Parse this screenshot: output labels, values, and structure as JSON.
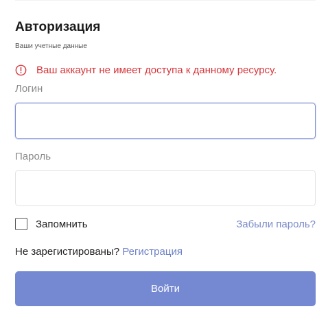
{
  "auth": {
    "title": "Авторизация",
    "subtitle": "Ваши учетные данные",
    "error_message": "Ваш аккаунт не имеет доступа к данному ресурсу.",
    "error_icon": "alert-circle-icon",
    "login_label": "Логин",
    "login_value": "",
    "password_label": "Пароль",
    "password_value": "",
    "remember_label": "Запомнить",
    "remember_checked": false,
    "forgot_password_link": "Забыли пароль?",
    "not_registered_text": "Не зарегистированы?",
    "register_link": "Регистрация",
    "submit_label": "Войти"
  },
  "colors": {
    "error": "#d6353a",
    "link": "#7b8cc9",
    "button": "#7589d2",
    "input_focus_border": "#7d8fd2"
  }
}
